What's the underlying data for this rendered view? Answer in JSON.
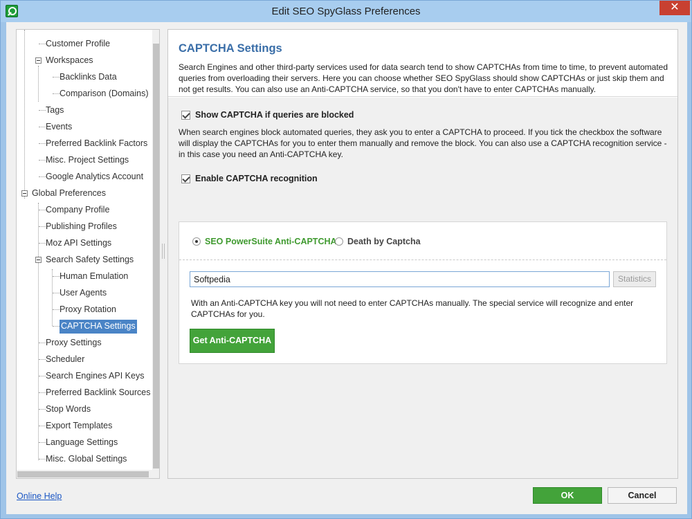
{
  "window": {
    "title": "Edit SEO SpyGlass Preferences",
    "close_glyph": "✕"
  },
  "tree": {
    "items": [
      {
        "label": "Customer Profile"
      },
      {
        "label": "Workspaces"
      },
      {
        "label": "Backlinks Data"
      },
      {
        "label": "Comparison (Domains)"
      },
      {
        "label": "Tags"
      },
      {
        "label": "Events"
      },
      {
        "label": "Preferred Backlink Factors"
      },
      {
        "label": "Misc. Project Settings"
      },
      {
        "label": "Google Analytics Account"
      },
      {
        "label": "Global Preferences"
      },
      {
        "label": "Company Profile"
      },
      {
        "label": "Publishing Profiles"
      },
      {
        "label": "Moz API Settings"
      },
      {
        "label": "Search Safety Settings"
      },
      {
        "label": "Human Emulation"
      },
      {
        "label": "User Agents"
      },
      {
        "label": "Proxy Rotation"
      },
      {
        "label": "CAPTCHA Settings"
      },
      {
        "label": "Proxy Settings"
      },
      {
        "label": "Scheduler"
      },
      {
        "label": "Search Engines API Keys"
      },
      {
        "label": "Preferred Backlink Sources"
      },
      {
        "label": "Stop Words"
      },
      {
        "label": "Export Templates"
      },
      {
        "label": "Language Settings"
      },
      {
        "label": "Misc. Global Settings"
      }
    ],
    "selected": "CAPTCHA Settings"
  },
  "content": {
    "title": "CAPTCHA Settings",
    "description": "Search Engines and other third-party services used for data search tend to show CAPTCHAs from time to time, to prevent automated queries from overloading their servers. Here you can choose whether SEO SpyGlass should show CAPTCHAs or just skip them and not get results. You can also use an Anti-CAPTCHA service, so that you don't have to enter CAPTCHAs manually.",
    "show_captcha": {
      "label": "Show CAPTCHA if queries are blocked",
      "checked": true,
      "help": "When search engines block automated queries, they ask you to enter a CAPTCHA to proceed. If you tick the checkbox the software will display the CAPTCHAs for you to enter them manually and remove the block. You can also use a CAPTCHA recognition service - in this case you need an Anti-CAPTCHA key."
    },
    "enable_recognition": {
      "label": "Enable CAPTCHA recognition",
      "checked": true
    },
    "services": [
      {
        "label": "SEO PowerSuite Anti-CAPTCHA",
        "selected": true
      },
      {
        "label": "Death by Captcha",
        "selected": false
      }
    ],
    "key_input": {
      "value": "Softpedia"
    },
    "statistics_label": "Statistics",
    "key_help": "With an Anti-CAPTCHA key you will not need to enter CAPTCHAs manually. The special service will recognize and enter CAPTCHAs for you.",
    "get_key_label": "Get Anti-CAPTCHA"
  },
  "footer": {
    "help_link": "Online Help",
    "ok_label": "OK",
    "cancel_label": "Cancel"
  },
  "colors": {
    "accent_green": "#43a33a",
    "title_blue": "#3a6ea8",
    "selection_blue": "#4a84c6",
    "link_blue": "#1a56c4",
    "close_red": "#c84031"
  }
}
